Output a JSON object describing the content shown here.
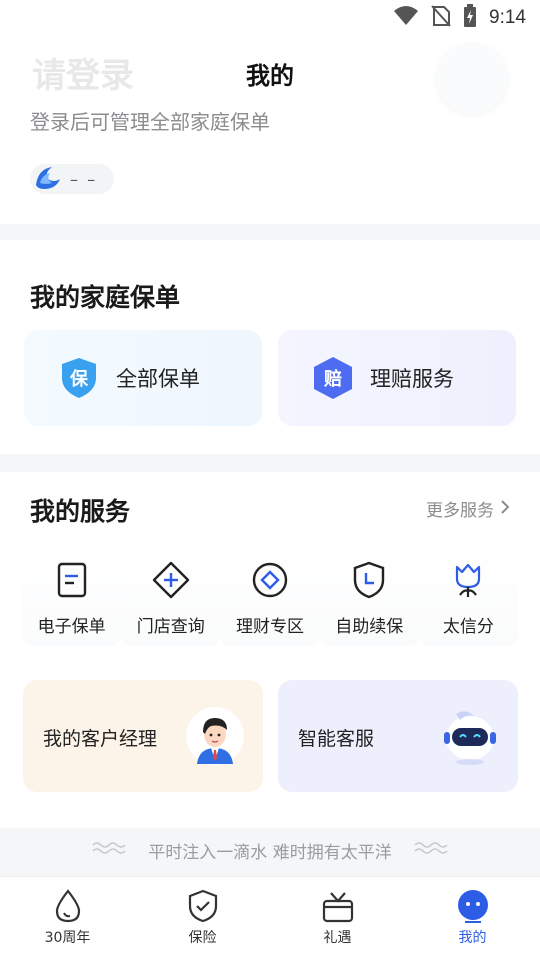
{
  "status_bar": {
    "time": "9:14"
  },
  "header": {
    "login_title": "请登录",
    "page_title": "我的",
    "login_hint": "登录后可管理全部家庭保单",
    "level_value": "– –"
  },
  "family": {
    "title": "我的家庭保单",
    "cards": [
      {
        "label": "全部保单",
        "icon": "shield-icon",
        "badge": "保"
      },
      {
        "label": "理赔服务",
        "icon": "claim-icon",
        "badge": "赔"
      }
    ]
  },
  "services": {
    "title": "我的服务",
    "more_label": "更多服务",
    "items": [
      {
        "label": "电子保单",
        "icon": "document-icon"
      },
      {
        "label": "门店查询",
        "icon": "store-locate-icon"
      },
      {
        "label": "理财专区",
        "icon": "finance-icon"
      },
      {
        "label": "自助续保",
        "icon": "renew-icon"
      },
      {
        "label": "太信分",
        "icon": "credit-score-icon"
      }
    ],
    "manager_label": "我的客户经理",
    "smart_service_label": "智能客服"
  },
  "slogan": "平时注入一滴水 难时拥有太平洋",
  "tabbar": {
    "items": [
      {
        "label": "30周年",
        "icon": "drop-icon"
      },
      {
        "label": "保险",
        "icon": "shield-check-icon"
      },
      {
        "label": "礼遇",
        "icon": "gift-icon"
      },
      {
        "label": "我的",
        "icon": "profile-face-icon"
      }
    ],
    "active_index": 3
  },
  "colors": {
    "accent": "#2d5ce6",
    "shield_blue": "#3aa0f0",
    "claim_blue": "#4d6cf2",
    "manager_bg": "#fdf4e9",
    "service_bg": "#eeeffd"
  }
}
